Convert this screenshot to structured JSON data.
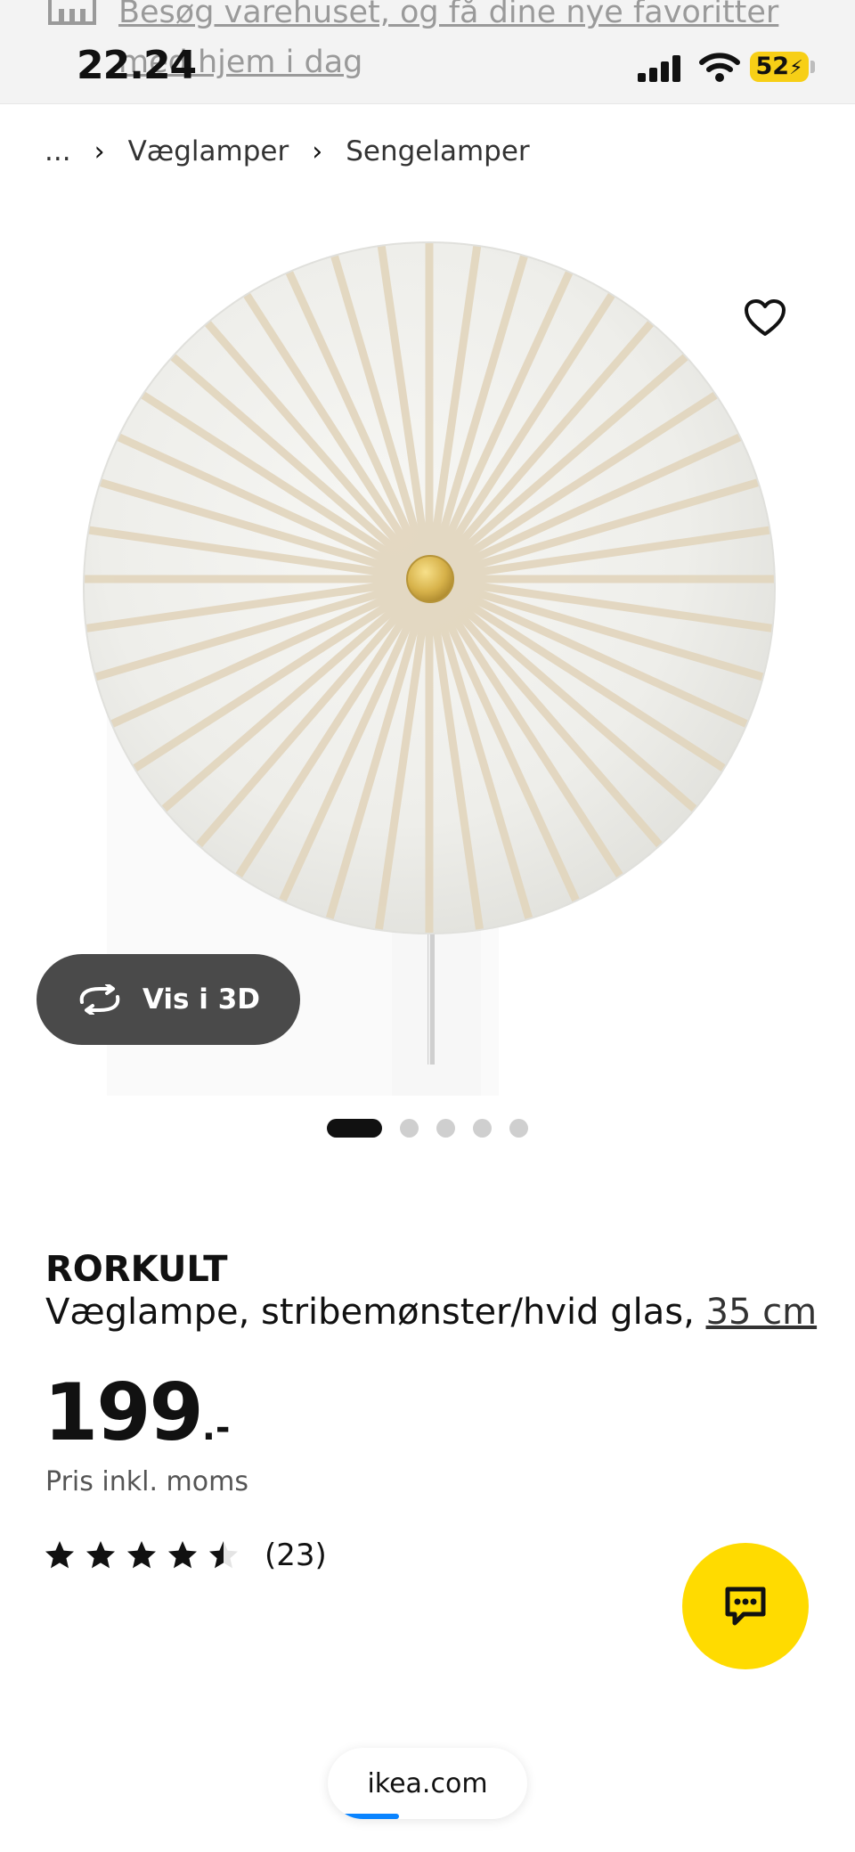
{
  "status_bar": {
    "time": "22.24",
    "battery": "52",
    "promo_text": "Besøg varehuset, og få dine nye favoritter med hjem i dag",
    "icons": [
      "store-icon",
      "signal-icon",
      "wifi-icon",
      "battery-icon"
    ]
  },
  "breadcrumb": {
    "ellipsis": "...",
    "items": [
      "Væglamper",
      "Sengelamper"
    ]
  },
  "gallery": {
    "vis3d_label": "Vis i 3D",
    "dot_count": 5,
    "active_index": 0
  },
  "product": {
    "brand": "RORKULT",
    "description": "Væglampe, stribemønster/hvid glas, ",
    "size": "35 cm",
    "price": "199",
    "price_suffix": ".-",
    "price_note": "Pris inkl. moms",
    "rating": {
      "value": 4.5,
      "max": 5,
      "count": "(23)"
    }
  },
  "browser": {
    "url": "ikea.com"
  },
  "colors": {
    "accent_yellow": "#ffdb00",
    "dark_button": "#4a4a4a",
    "battery_yellow": "#f7cf16",
    "link_blue": "#0a84ff"
  }
}
